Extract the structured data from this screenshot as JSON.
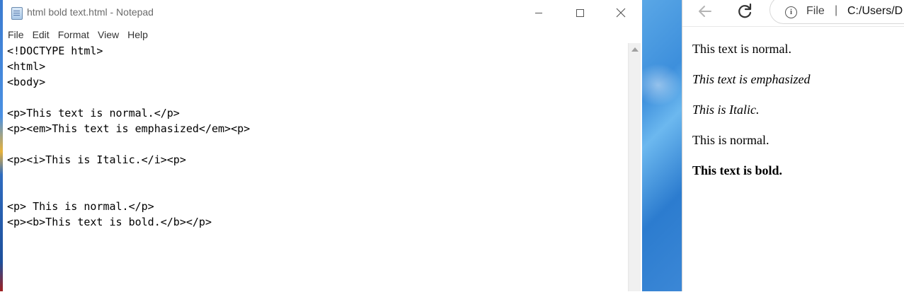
{
  "notepad": {
    "title": "html bold text.html - Notepad",
    "menu": [
      "File",
      "Edit",
      "Format",
      "View",
      "Help"
    ],
    "lines": [
      "<!DOCTYPE html>",
      "<html>",
      "<body>",
      "",
      "<p>This text is normal.</p>",
      "<p><em>This text is emphasized</em><p>",
      "",
      "<p><i>This is Italic.</i><p>",
      "",
      "",
      "<p> This is normal.</p>",
      "<p><b>This text is bold.</b></p>"
    ]
  },
  "browser": {
    "address": {
      "scheme": "File",
      "separator": "|",
      "url": "C:/Users/D"
    },
    "paragraphs": [
      {
        "text": "This text is normal.",
        "style": "normal"
      },
      {
        "text": "This text is emphasized",
        "style": "italic"
      },
      {
        "text": "This is Italic.",
        "style": "italic"
      },
      {
        "text": "This is normal.",
        "style": "normal"
      },
      {
        "text": "This text is bold.",
        "style": "bold"
      }
    ]
  }
}
